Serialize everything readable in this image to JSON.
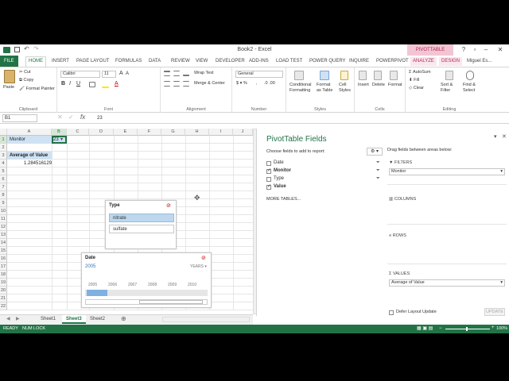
{
  "window": {
    "title": "Book2 - Excel",
    "contextual_tab": "PIVOTTABLE TOOLS",
    "user": "Miguel Es..."
  },
  "ribbon_tabs": [
    "FILE",
    "HOME",
    "INSERT",
    "PAGE LAYOUT",
    "FORMULAS",
    "DATA",
    "REVIEW",
    "VIEW",
    "DEVELOPER",
    "ADD-INS",
    "LOAD TEST",
    "POWER QUERY",
    "INQUIRE",
    "POWERPIVOT",
    "ANALYZE",
    "DESIGN"
  ],
  "ribbon": {
    "clipboard": {
      "paste": "Paste",
      "cut": "Cut",
      "copy": "Copy",
      "format_painter": "Format Painter",
      "label": "Clipboard"
    },
    "font": {
      "name": "Calibri",
      "size": "11",
      "label": "Font"
    },
    "alignment": {
      "wrap": "Wrap Text",
      "merge": "Merge & Center",
      "label": "Alignment"
    },
    "number": {
      "format": "General",
      "label": "Number"
    },
    "styles": {
      "conditional": "Conditional Formatting",
      "format_table": "Format as Table",
      "cell_styles": "Cell Styles",
      "label": "Styles"
    },
    "cells": {
      "insert": "Insert",
      "delete": "Delete",
      "format": "Format",
      "label": "Cells"
    },
    "editing": {
      "autosum": "AutoSum",
      "fill": "Fill",
      "clear": "Clear",
      "sort": "Sort & Filter",
      "find": "Find & Select",
      "label": "Editing"
    }
  },
  "formula_bar": {
    "name_box": "B1",
    "formula": "23"
  },
  "columns": [
    "A",
    "B",
    "C",
    "D",
    "E",
    "F",
    "G",
    "H",
    "I",
    "J"
  ],
  "rows": [
    "1",
    "2",
    "3",
    "4",
    "5",
    "6",
    "7",
    "8",
    "9",
    "10",
    "11",
    "12",
    "13",
    "14",
    "15",
    "16",
    "17",
    "18",
    "19",
    "20",
    "21",
    "22"
  ],
  "cells": {
    "a1": "Monitor",
    "b1": "23",
    "a3": "Average of Value",
    "a4": "1.284516129"
  },
  "slicer_type": {
    "title": "Type",
    "items": [
      "nitrate",
      "sulfate"
    ]
  },
  "timeline": {
    "title": "Date",
    "selection": "2005",
    "level": "YEARS",
    "years": [
      "2005",
      "2006",
      "2007",
      "2008",
      "2009",
      "2010"
    ]
  },
  "sheets": [
    "Sheet1",
    "Sheet3",
    "Sheet2"
  ],
  "active_sheet": "Sheet3",
  "status": {
    "ready": "READY",
    "numlock": "NUM LOCK",
    "zoom": "100%"
  },
  "pivot_pane": {
    "title": "PivotTable Fields",
    "choose": "Choose fields to add to report:",
    "fields": [
      {
        "name": "Date",
        "checked": false
      },
      {
        "name": "Monitor",
        "checked": true
      },
      {
        "name": "Type",
        "checked": false
      },
      {
        "name": "Value",
        "checked": true
      }
    ],
    "more_tables": "MORE TABLES...",
    "drag_hint": "Drag fields between areas below:",
    "filters_label": "FILTERS",
    "filters_value": "Monitor",
    "columns_label": "COLUMNS",
    "rows_label": "ROWS",
    "values_label": "VALUES",
    "values_value": "Average of Value",
    "defer": "Defer Layout Update",
    "update": "UPDATE"
  },
  "colors": {
    "excel_green": "#217346",
    "pivot_pink": "#b02a57",
    "selection_blue": "#cfe2f3"
  }
}
